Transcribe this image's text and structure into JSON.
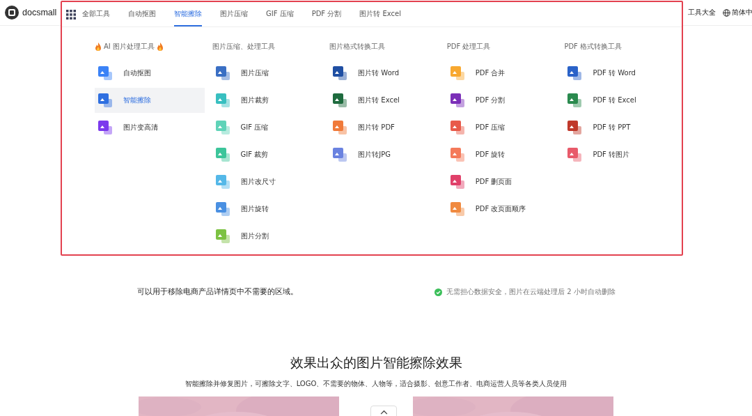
{
  "header": {
    "logo": "docsmall",
    "nav": [
      {
        "label": "全部工具",
        "selected": false
      },
      {
        "label": "自动抠图",
        "selected": false
      },
      {
        "label": "智能擦除",
        "selected": true
      },
      {
        "label": "图片压缩",
        "selected": false
      },
      {
        "label": "GIF 压缩",
        "selected": false
      },
      {
        "label": "PDF 分割",
        "selected": false
      },
      {
        "label": "图片转 Excel",
        "selected": false
      }
    ],
    "right_links": [
      "工具大全"
    ],
    "language": "简体中"
  },
  "menu": {
    "columns": [
      {
        "heading": "AI 图片处理工具",
        "flames": true,
        "items": [
          {
            "label": "自动抠图",
            "selected": false,
            "color": "#3b82f6"
          },
          {
            "label": "智能擦除",
            "selected": true,
            "color": "#2f6fe0"
          },
          {
            "label": "图片变高清",
            "selected": false,
            "color": "#7c3aed"
          }
        ]
      },
      {
        "heading": "图片压缩、处理工具",
        "flames": false,
        "items": [
          {
            "label": "图片压缩",
            "selected": false,
            "color": "#3a6fc4"
          },
          {
            "label": "图片裁剪",
            "selected": false,
            "color": "#38bfc0"
          },
          {
            "label": "GIF 压缩",
            "selected": false,
            "color": "#5fd3b8"
          },
          {
            "label": "GIF 裁剪",
            "selected": false,
            "color": "#3cc59a"
          },
          {
            "label": "图片改尺寸",
            "selected": false,
            "color": "#54b8e8"
          },
          {
            "label": "图片旋转",
            "selected": false,
            "color": "#4a90e2"
          },
          {
            "label": "图片分割",
            "selected": false,
            "color": "#7cc242"
          }
        ]
      },
      {
        "heading": "图片格式转换工具",
        "flames": false,
        "items": [
          {
            "label": "图片转 Word",
            "selected": false,
            "color": "#1f4fa3"
          },
          {
            "label": "图片转 Excel",
            "selected": false,
            "color": "#1e6b3e"
          },
          {
            "label": "图片转 PDF",
            "selected": false,
            "color": "#f07a3a"
          },
          {
            "label": "图片转JPG",
            "selected": false,
            "color": "#6a82e0"
          }
        ]
      },
      {
        "heading": "PDF 处理工具",
        "flames": false,
        "items": [
          {
            "label": "PDF 合并",
            "selected": false,
            "color": "#f8a830"
          },
          {
            "label": "PDF 分割",
            "selected": false,
            "color": "#7b2fb8"
          },
          {
            "label": "PDF 压缩",
            "selected": false,
            "color": "#e85a4a"
          },
          {
            "label": "PDF 旋转",
            "selected": false,
            "color": "#f47a5a"
          },
          {
            "label": "PDF 删页面",
            "selected": false,
            "color": "#e0406a"
          },
          {
            "label": "PDF 改页面顺序",
            "selected": false,
            "color": "#f08a40"
          }
        ]
      },
      {
        "heading": "PDF 格式转换工具",
        "flames": false,
        "items": [
          {
            "label": "PDF 转 Word",
            "selected": false,
            "color": "#2a62c8"
          },
          {
            "label": "PDF 转 Excel",
            "selected": false,
            "color": "#2a8a4e"
          },
          {
            "label": "PDF 转 PPT",
            "selected": false,
            "color": "#c0392b"
          },
          {
            "label": "PDF 转图片",
            "selected": false,
            "color": "#e85a6a"
          }
        ]
      }
    ]
  },
  "intro": {
    "text": "可以用于移除电商产品详情页中不需要的区域。",
    "note": "无需担心数据安全，图片在云端处理后 2 小时自动删除"
  },
  "showcase": {
    "title": "效果出众的图片智能擦除效果",
    "subtitle": "智能擦除并修复图片，可擦除文字、LOGO、不需要的物体、人物等，适合摄影、创意工作者、电商运营人员等各类人员使用"
  }
}
